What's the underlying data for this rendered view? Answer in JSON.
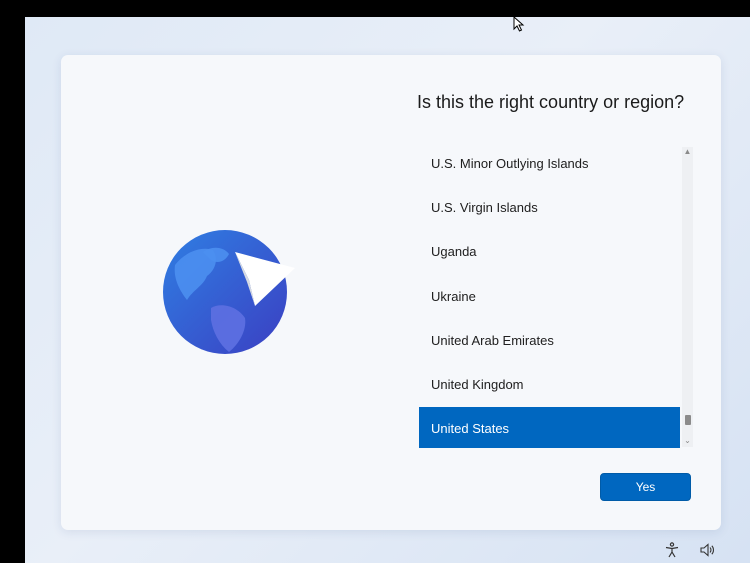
{
  "dialog": {
    "title": "Is this the right country or region?",
    "countries": [
      "U.S. Minor Outlying Islands",
      "U.S. Virgin Islands",
      "Uganda",
      "Ukraine",
      "United Arab Emirates",
      "United Kingdom",
      "United States"
    ],
    "selected_country": "United States",
    "yes_label": "Yes"
  },
  "icons": {
    "illustration": "globe-with-paper-plane-icon",
    "accessibility": "accessibility-icon",
    "volume": "speaker-icon",
    "cursor": "mouse-cursor-icon"
  },
  "colors": {
    "accent": "#0067c0",
    "card": "#f6f8fb"
  }
}
